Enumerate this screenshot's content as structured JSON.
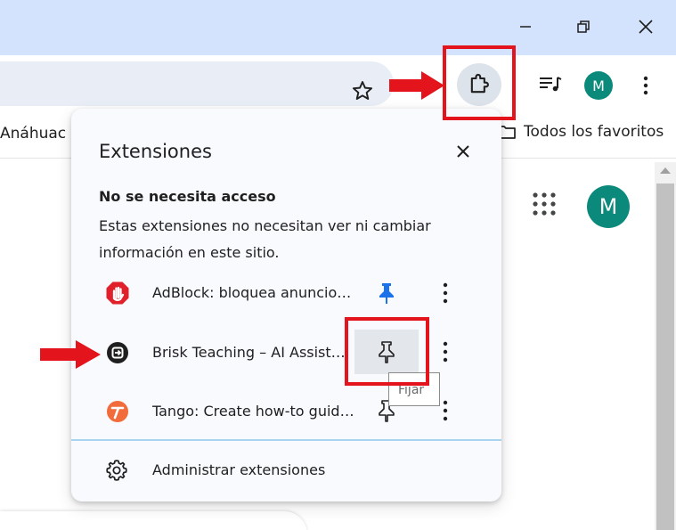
{
  "bookmarks_bar": {
    "left_label": "Anáhuac M",
    "all_bookmarks_label": "Todos los favoritos"
  },
  "profile": {
    "initial": "M"
  },
  "extensions_panel": {
    "title": "Extensiones",
    "section_heading": "No se necesita acceso",
    "section_description": "Estas extensiones no necesitan ver ni cambiar información en este sitio.",
    "items": [
      {
        "name": "AdBlock: bloquea anuncios y ventanas emergentes",
        "pinned": true
      },
      {
        "name": "Brisk Teaching – AI Assistant for Teachers",
        "pinned": false
      },
      {
        "name": "Tango: Create how-to guides with screenshots",
        "pinned": false
      }
    ],
    "tooltip": "Fijar",
    "manage_label": "Administrar extensiones"
  },
  "colors": {
    "titlebar": "#d3e3fd",
    "omnibox": "#e9eef6",
    "panel_bg": "#f8fafd",
    "avatar": "#0b8a7c",
    "pin_active": "#1a73e8",
    "highlight_red": "#e3141b",
    "adblock_red": "#e0202a",
    "tango_orange": "#f26b3a"
  }
}
